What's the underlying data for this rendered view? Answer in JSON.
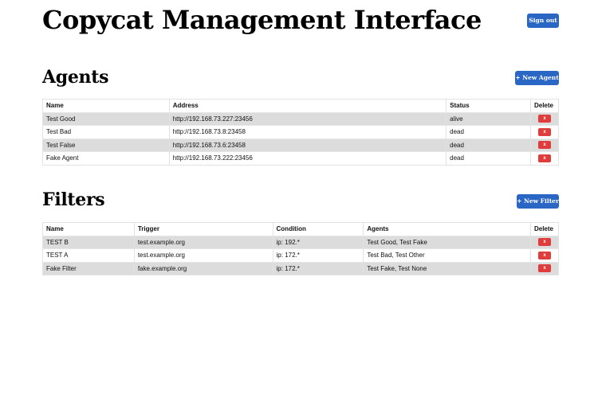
{
  "page": {
    "title": "Copycat Management Interface",
    "sign_out": "Sign out"
  },
  "agents": {
    "heading": "Agents",
    "new_button": "+ New Agent",
    "columns": [
      "Name",
      "Address",
      "Status",
      "Delete"
    ],
    "rows": [
      {
        "name": "Test Good",
        "address": "http://192.168.73.227:23456",
        "status": "alive",
        "delete": "x"
      },
      {
        "name": "Test Bad",
        "address": "http://192.168.73.8:23458",
        "status": "dead",
        "delete": "x"
      },
      {
        "name": "Test False",
        "address": "http://192.168.73.6:23458",
        "status": "dead",
        "delete": "x"
      },
      {
        "name": "Fake Agent",
        "address": "http://192.168.73.222:23456",
        "status": "dead",
        "delete": "x"
      }
    ]
  },
  "filters": {
    "heading": "Filters",
    "new_button": "+ New Filter",
    "columns": [
      "Name",
      "Trigger",
      "Condition",
      "Agents",
      "Delete"
    ],
    "rows": [
      {
        "name": "TEST B",
        "trigger": "test.example.org",
        "condition": "ip: 192.*",
        "agents": "Test Good, Test Fake",
        "delete": "x"
      },
      {
        "name": "TEST A",
        "trigger": "test.example.org",
        "condition": "ip: 172.*",
        "agents": "Test Bad, Test Other",
        "delete": "x"
      },
      {
        "name": "Fake Filter",
        "trigger": "fake.example.org",
        "condition": "ip: 172.*",
        "agents": "Test Fake, Test None",
        "delete": "x"
      }
    ]
  },
  "colors": {
    "primary": "#2a66c4",
    "danger": "#e03c3c",
    "row_alt": "#dcdcdc"
  }
}
